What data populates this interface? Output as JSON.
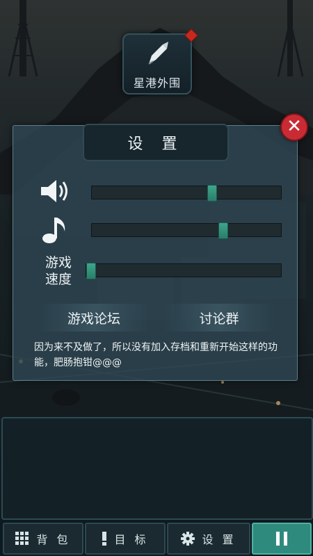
{
  "location": {
    "name": "星港外围"
  },
  "settings": {
    "title": "设 置",
    "volume": {
      "level": 0.64
    },
    "music": {
      "level": 0.7
    },
    "speed": {
      "label_line1": "游戏",
      "label_line2": "速度",
      "level": 0.0
    },
    "forum_label": "游戏论坛",
    "group_label": "讨论群",
    "note": "因为来不及做了，所以没有加入存档和重新开始这样的功能，肥肠抱钳@@@"
  },
  "bottom_bar": {
    "backpack_label": "背 包",
    "goal_label": "目 标",
    "settings_label": "设 置"
  },
  "colors": {
    "accent": "#2f8a7e",
    "close": "#c92b34",
    "knob": "#3fa58d"
  }
}
